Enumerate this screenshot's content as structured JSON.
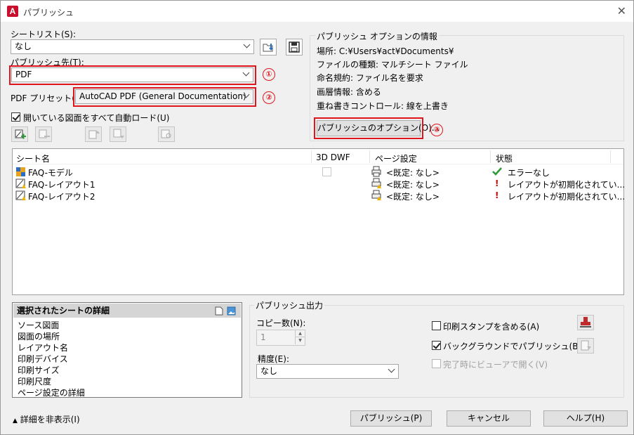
{
  "window": {
    "title": "パブリッシュ",
    "app_icon": "A",
    "close": "✕"
  },
  "sheet_list": {
    "label": "シートリスト(S):",
    "value": "なし"
  },
  "publish_to": {
    "label": "パブリッシュ先(T):",
    "value": "PDF",
    "marker": "①"
  },
  "pdf_preset": {
    "label": "PDF プリセット(P):",
    "value": "AutoCAD PDF (General Documentation)",
    "marker": "②"
  },
  "auto_load": {
    "label": "開いている図面をすべて自動ロード(U)",
    "checked": true
  },
  "options_info": {
    "title": "パブリッシュ オプションの情報",
    "lines": [
      "場所: C:¥Users¥act¥Documents¥",
      "ファイルの種類: マルチシート ファイル",
      "命名規約: ファイル名を要求",
      "画層情報: 含める",
      "重ね書きコントロール: 線を上書き"
    ],
    "options_button": "パブリッシュのオプション(O)...",
    "marker": "③"
  },
  "sheets_table": {
    "headers": [
      "シート名",
      "3D DWF",
      "ページ設定",
      "状態"
    ],
    "rows": [
      {
        "name": "FAQ-モデル",
        "page_setup": "<既定: なし>",
        "status": "エラーなし",
        "status_kind": "ok"
      },
      {
        "name": "FAQ-レイアウト1",
        "page_setup": "<既定: なし>",
        "status": "レイアウトが初期化されてい...",
        "status_kind": "warn"
      },
      {
        "name": "FAQ-レイアウト2",
        "page_setup": "<既定: なし>",
        "status": "レイアウトが初期化されてい...",
        "status_kind": "warn"
      }
    ]
  },
  "selected_details": {
    "title": "選択されたシートの詳細",
    "items": [
      "ソース図面",
      "図面の場所",
      "レイアウト名",
      "印刷デバイス",
      "印刷サイズ",
      "印刷尺度",
      "ページ設定の詳細"
    ]
  },
  "publish_output": {
    "title": "パブリッシュ出力",
    "copies_label": "コピー数(N):",
    "copies_value": "1",
    "precision_label": "精度(E):",
    "precision_value": "なし",
    "include_stamp": {
      "label": "印刷スタンプを含める(A)",
      "checked": false
    },
    "background": {
      "label": "バックグラウンドでパブリッシュ(B)",
      "checked": true
    },
    "open_viewer": {
      "label": "完了時にビューアで開く(V)",
      "checked": false,
      "disabled": true
    }
  },
  "footer": {
    "hide_details": "詳細を非表示(I)",
    "publish": "パブリッシュ(P)",
    "cancel": "キャンセル",
    "help": "ヘルプ(H)"
  },
  "colors": {
    "highlight": "#e0141c",
    "check_green": "#2e9b3a",
    "warn_red": "#d40000"
  }
}
